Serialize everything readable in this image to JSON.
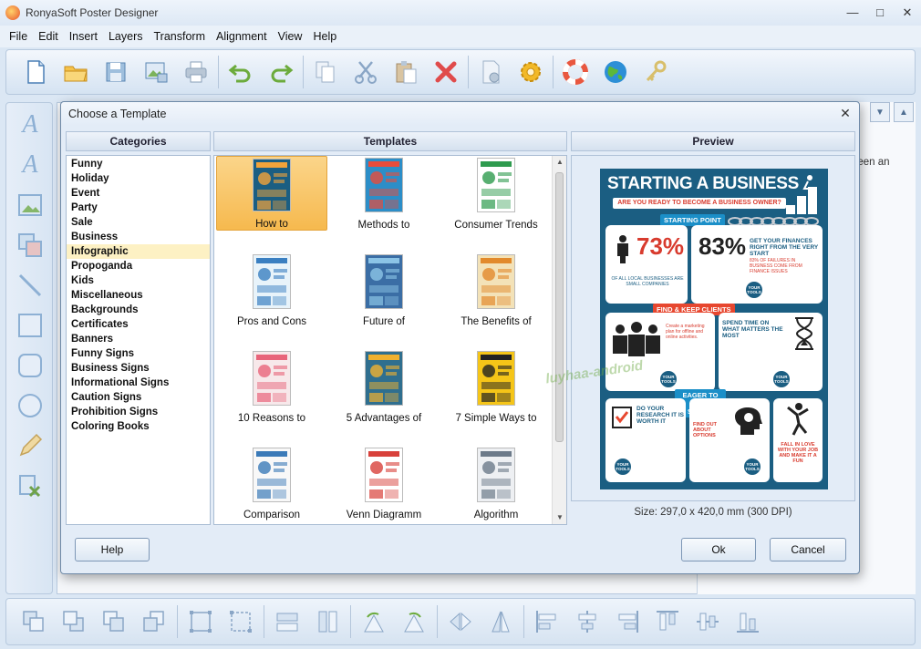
{
  "window": {
    "title": "RonyaSoft Poster Designer",
    "controls": {
      "minimize": "—",
      "maximize": "□",
      "close": "✕"
    }
  },
  "menu": [
    "File",
    "Edit",
    "Insert",
    "Layers",
    "Transform",
    "Alignment",
    "View",
    "Help"
  ],
  "toolbar_icons": [
    "new-file-icon",
    "open-folder-icon",
    "save-icon",
    "export-image-icon",
    "print-icon",
    "undo-icon",
    "redo-icon",
    "copy-icon",
    "cut-icon",
    "paste-icon",
    "delete-icon",
    "page-settings-icon",
    "gear-icon",
    "lifebuoy-icon",
    "globe-icon",
    "key-icon"
  ],
  "workspace": {
    "right_text": "been an"
  },
  "dialog": {
    "title": "Choose a Template",
    "close": "✕",
    "categories_header": "Categories",
    "templates_header": "Templates",
    "preview_header": "Preview",
    "categories": [
      "Funny",
      "Holiday",
      "Event",
      "Party",
      "Sale",
      "Business",
      "Infographic",
      "Propoganda",
      "Kids",
      "Miscellaneous",
      "Backgrounds",
      "Certificates",
      "Banners",
      "Funny Signs",
      "Business Signs",
      "Informational Signs",
      "Caution Signs",
      "Prohibition Signs",
      "Coloring Books"
    ],
    "selected_category": "Infographic",
    "templates": [
      {
        "label": "How to",
        "selected": true
      },
      {
        "label": "Methods to",
        "selected": false
      },
      {
        "label": "Consumer Trends",
        "selected": false
      },
      {
        "label": "Pros and Cons",
        "selected": false
      },
      {
        "label": "Future of",
        "selected": false
      },
      {
        "label": "The Benefits of",
        "selected": false
      },
      {
        "label": "10 Reasons to",
        "selected": false
      },
      {
        "label": "5 Advantages of",
        "selected": false
      },
      {
        "label": "7 Simple Ways to",
        "selected": false
      },
      {
        "label": "Comparison",
        "selected": false
      },
      {
        "label": "Venn Diagramm",
        "selected": false
      },
      {
        "label": "Algorithm",
        "selected": false
      }
    ],
    "preview_size": "Size: 297,0 x 420,0 mm (300 DPI)",
    "buttons": {
      "help": "Help",
      "ok": "Ok",
      "cancel": "Cancel"
    }
  },
  "poster": {
    "title": "STARTING A BUSINESS",
    "banner": "ARE YOU READY TO BECOME A BUSINESS OWNER?",
    "tag_starting_point": "STARTING POINT",
    "stat1": "73%",
    "stat1_text": "OF ALL LOCAL BUSINESSES ARE SMALL COMPANIES",
    "stat2": "83%",
    "stat2_head": "GET YOUR FINANCES RIGHT FROM THE VERY START",
    "stat2_text": "83% OF FAILURES IN BUSINESS COME FROM FINANCE ISSUES",
    "tag_find_clients": "FIND & KEEP CLIENTS",
    "spend_time": "SPEND TIME ON WHAT MATTERS THE MOST",
    "tag_eager": "EAGER TO HIRE STAFF?",
    "research": "DO YOUR RESEARCH IT IS WORTH IT",
    "find_out": "FIND OUT ABOUT OPTIONS",
    "fall_in_love": "FALL IN LOVE WITH YOUR JOB AND MAKE IT A FUN",
    "your_tools": "YOUR TOOLS"
  },
  "watermark": "luyhaa-android"
}
